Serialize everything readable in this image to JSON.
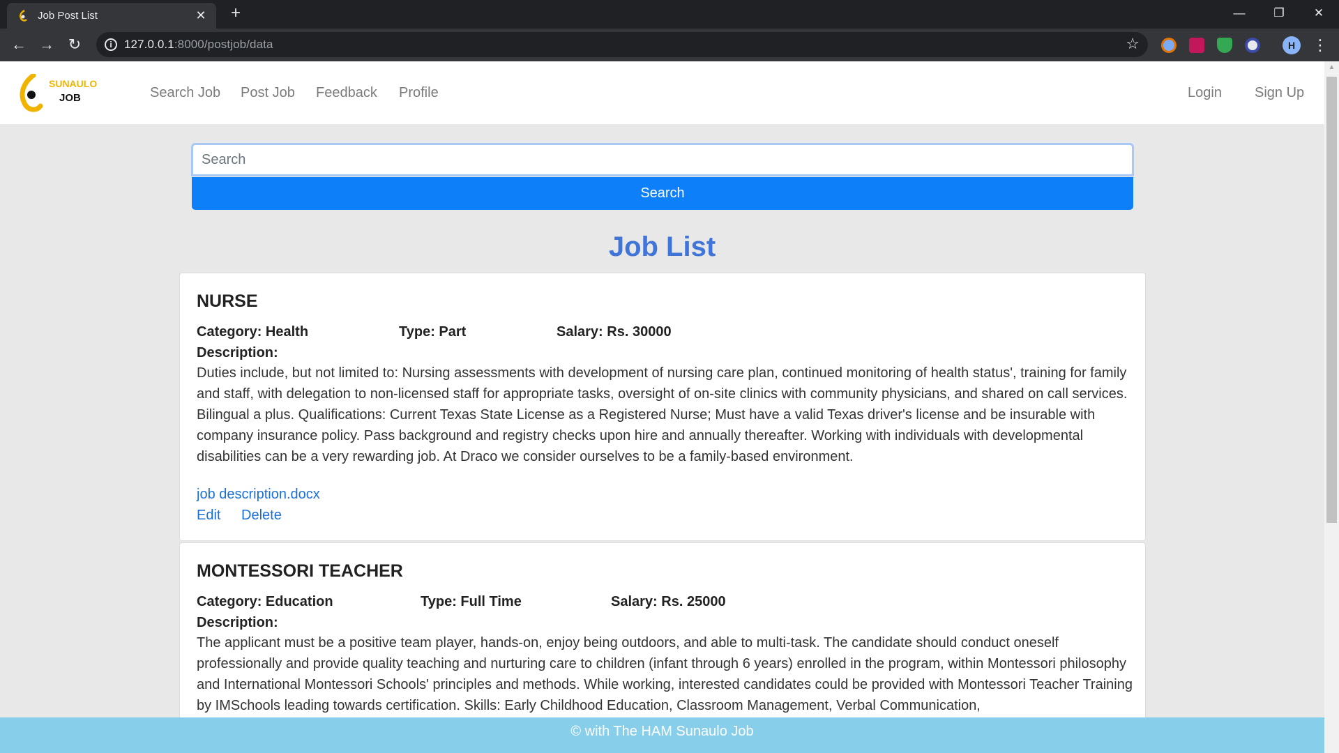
{
  "browser": {
    "tab_title": "Job Post List",
    "url_host": "127.0.0.1",
    "url_rest": ":8000/postjob/data"
  },
  "site": {
    "logo_top": "SUNAULO",
    "logo_bottom": "JOB",
    "nav": {
      "search_job": "Search Job",
      "post_job": "Post Job",
      "feedback": "Feedback",
      "profile": "Profile",
      "login": "Login",
      "signup": "Sign Up"
    },
    "accent_color": "#0d7ff9",
    "title_color": "#3f74d8",
    "footer_color": "#87ceeb"
  },
  "search": {
    "placeholder": "Search",
    "button_label": "Search"
  },
  "page_title": "Job List",
  "jobs": [
    {
      "title": "NURSE",
      "category": "Category: Health",
      "type": "Type: Part",
      "salary": "Salary: Rs. 30000",
      "description_label": "Description:",
      "description": "Duties include, but not limited to: Nursing assessments with development of nursing care plan, continued monitoring of health status', training for family and staff, with delegation to non-licensed staff for appropriate tasks, oversight of on-site clinics with community physicians, and shared on call services. Bilingual a plus. Qualifications: Current Texas State License as a Registered Nurse; Must have a valid Texas driver's license and be insurable with company insurance policy. Pass background and registry checks upon hire and annually thereafter. Working with individuals with developmental disabilities can be a very rewarding job. At Draco we consider ourselves to be a family-based environment.",
      "document": "job description.docx",
      "edit": "Edit",
      "delete": "Delete"
    },
    {
      "title": "MONTESSORI TEACHER",
      "category": "Category: Education",
      "type": "Type: Full Time",
      "salary": "Salary: Rs. 25000",
      "description_label": "Description:",
      "description": "The applicant must be a positive team player, hands-on, enjoy being outdoors, and able to multi-task. The candidate should conduct oneself professionally and provide quality teaching and nurturing care to children (infant through 6 years) enrolled in the program, within Montessori philosophy and International Montessori Schools' principles and methods. While working, interested candidates could be provided with Montessori Teacher Training by IMSchools leading towards certification. Skills: Early Childhood Education, Classroom Management, Verbal Communication,"
    }
  ],
  "footer": "© with The HAM Sunaulo Job"
}
